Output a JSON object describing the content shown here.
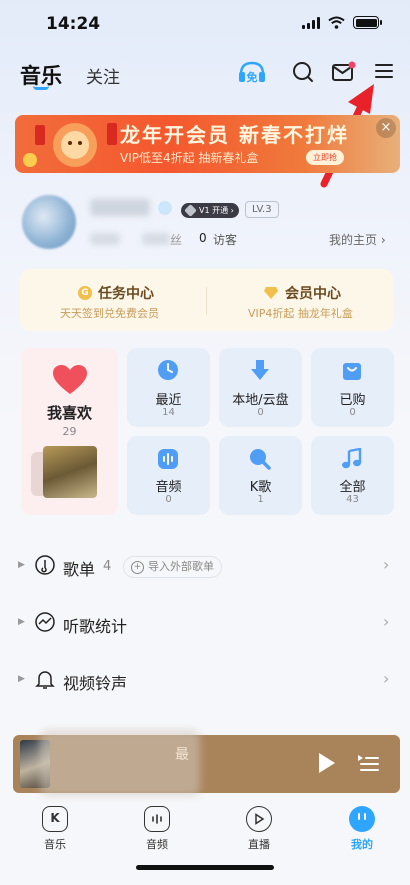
{
  "status_bar": {
    "time": "14:24"
  },
  "header": {
    "tabs": [
      {
        "label": "音乐",
        "active": true
      },
      {
        "label": "关注",
        "active": false
      }
    ],
    "icons": [
      "free-listen-icon",
      "search-icon",
      "mail-icon",
      "menu-icon"
    ],
    "free_badge": "免"
  },
  "banner": {
    "title": "龙年开会员 新春不打烊",
    "subtitle": "VIP低至4折起 抽新春礼盒",
    "button_label": "立即抢",
    "close": "×"
  },
  "profile": {
    "vip_badge": "V1 开通 ›",
    "level": "LV.3",
    "fans_label": "丝",
    "visitors_count": "0",
    "visitors_label": "访客",
    "home_link": "我的主页 ›"
  },
  "tasks": {
    "task_center": {
      "title": "任务中心",
      "subtitle": "天天签到兑免费会员",
      "icon": "G"
    },
    "vip_center": {
      "title": "会员中心",
      "subtitle": "VIP4折起 抽龙年礼盒"
    }
  },
  "favorites": {
    "label": "我喜欢",
    "count": "29"
  },
  "grid": [
    {
      "label": "最近",
      "count": "14",
      "icon": "clock-icon"
    },
    {
      "label": "本地/云盘",
      "count": "0",
      "icon": "download-icon"
    },
    {
      "label": "已购",
      "count": "0",
      "icon": "bag-icon"
    },
    {
      "label": "音频",
      "count": "0",
      "icon": "audio-icon"
    },
    {
      "label": "K歌",
      "count": "1",
      "icon": "mic-icon"
    },
    {
      "label": "全部",
      "count": "43",
      "icon": "music-note-icon"
    }
  ],
  "list": [
    {
      "label": "歌单",
      "count": "4",
      "extra": "导入外部歌单"
    },
    {
      "label": "听歌统计"
    },
    {
      "label": "视频铃声"
    }
  ],
  "player": {
    "title_suffix": "最"
  },
  "bottom_nav": [
    {
      "label": "音乐",
      "glyph": "K"
    },
    {
      "label": "音频",
      "glyph": ""
    },
    {
      "label": "直播",
      "glyph": ""
    },
    {
      "label": "我的",
      "glyph": ""
    }
  ],
  "colors": {
    "accent": "#2ea6ff",
    "banner": "#f4582e",
    "player_bg": "#a9845b"
  }
}
